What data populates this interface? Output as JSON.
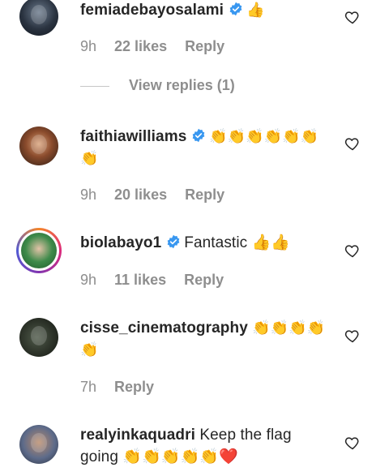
{
  "comments": [
    {
      "username": "femiadebayosalami",
      "verified": true,
      "text": "👍",
      "time": "9h",
      "likes": "22 likes",
      "reply": "Reply",
      "view_replies": "View replies (1)"
    },
    {
      "username": "faithiawilliams",
      "verified": true,
      "text": "👏👏👏👏👏👏👏",
      "time": "9h",
      "likes": "20 likes",
      "reply": "Reply"
    },
    {
      "username": "biolabayo1",
      "verified": true,
      "text": "Fantastic 👍👍",
      "time": "9h",
      "likes": "11 likes",
      "reply": "Reply"
    },
    {
      "username": "cisse_cinematography",
      "verified": false,
      "text": "👏👏👏👏👏",
      "time": "7h",
      "reply": "Reply"
    },
    {
      "username": "realyinkaquadri",
      "verified": false,
      "text": "Keep the flag going 👏👏👏👏👏❤️"
    }
  ],
  "colors": {
    "verified_badge": "#3897f0",
    "meta_text": "#8e8e8e",
    "primary_text": "#262626"
  },
  "icons": {
    "like": "heart-outline-icon",
    "verified": "verified-badge-icon"
  }
}
